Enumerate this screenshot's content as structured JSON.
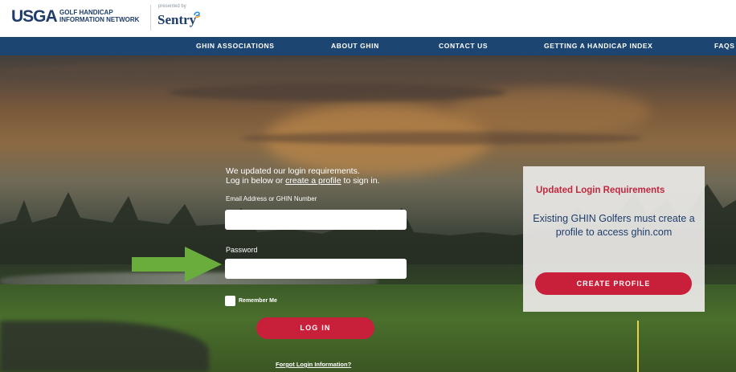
{
  "header": {
    "logo_text": "USGA",
    "network_line1": "GOLF HANDICAP",
    "network_line2": "INFORMATION NETWORK",
    "presented_by": "presented by",
    "sponsor": "Sentry"
  },
  "nav": {
    "items": [
      {
        "label": "GHIN ASSOCIATIONS"
      },
      {
        "label": "ABOUT GHIN"
      },
      {
        "label": "CONTACT US"
      },
      {
        "label": "GETTING A HANDICAP INDEX"
      },
      {
        "label": "FAQS"
      }
    ]
  },
  "login": {
    "intro_line1": "We updated our login requirements.",
    "intro_line2_prefix": "Log in below or ",
    "intro_link": "create a profile",
    "intro_line2_suffix": " to sign in.",
    "email_label": "Email Address or GHIN Number",
    "email_value": "",
    "password_label": "Password",
    "password_value": "",
    "remember_label": "Remember Me",
    "login_button": "LOG IN",
    "forgot_link": "Forgot Login Information?"
  },
  "panel": {
    "title": "Updated Login Requirements",
    "text": "Existing GHIN Golfers must create a profile to access ghin.com",
    "button": "CREATE PROFILE"
  },
  "colors": {
    "nav_bg": "#1c4571",
    "brand_red": "#c8203a",
    "brand_blue": "#1f3d6b",
    "arrow_green": "#6aad3c"
  }
}
